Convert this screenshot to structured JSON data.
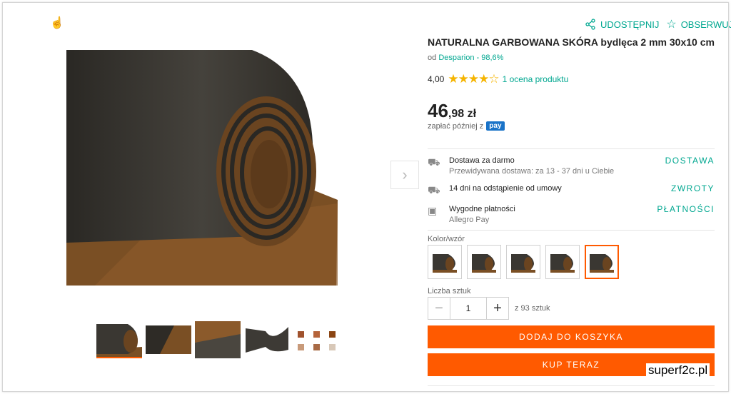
{
  "header": {
    "share_label": "UDOSTĘPNIJ",
    "watch_label": "OBSERWUJ"
  },
  "product": {
    "title": "NATURALNA GARBOWANA SKÓRA bydlęca 2 mm 30x10 cm",
    "seller_prefix": "od",
    "seller_name": "Desparion - 98,6%",
    "rating_value": "4,00",
    "rating_stars": 4,
    "rating_link": "1 ocena produktu",
    "price_int": "46",
    "price_dec": ",98 zł",
    "pay_later_text": "zapłać później z",
    "pay_badge": "pay"
  },
  "info_rows": [
    {
      "icon": "truck-icon",
      "title": "Dostawa za darmo",
      "subtitle": "Przewidywana dostawa: za 13 - 37 dni u Ciebie",
      "label": "DOSTAWA"
    },
    {
      "icon": "return-truck-icon",
      "title": "14 dni na odstąpienie od umowy",
      "subtitle": "",
      "label": "ZWROTY"
    },
    {
      "icon": "payment-icon",
      "title": "Wygodne płatności",
      "subtitle": "Allegro Pay",
      "label": "PŁATNOŚCI"
    }
  ],
  "variants": {
    "label": "Kolor/wzór",
    "count": 5,
    "selected_index": 4
  },
  "quantity": {
    "label": "Liczba sztuk",
    "value": "1",
    "available": "z 93 sztuk"
  },
  "buttons": {
    "add_to_cart": "DODAJ DO KOSZYKA",
    "buy_now": "KUP TERAZ"
  },
  "gallery": {
    "thumb_count": 5,
    "active_index": 0
  },
  "watermark": "superf2c.pl",
  "colors": {
    "accent": "#00a790",
    "primary_button": "#ff5a00",
    "star": "#f5b400"
  }
}
